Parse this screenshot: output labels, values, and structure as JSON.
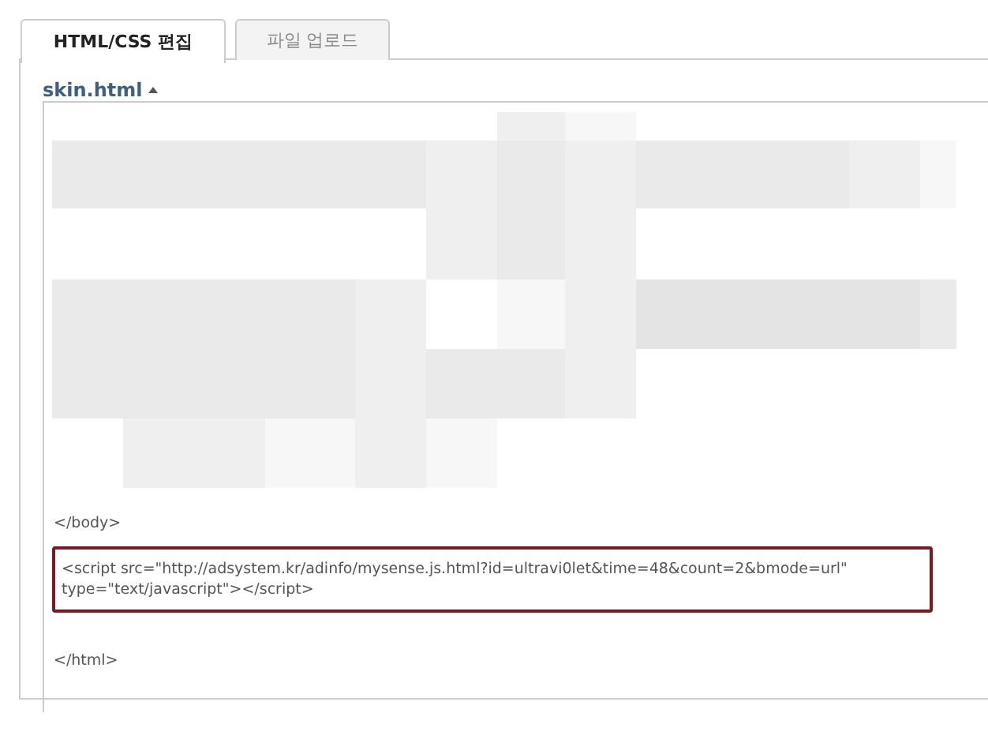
{
  "tabs": [
    {
      "label": "HTML/CSS 편집",
      "selected": true
    },
    {
      "label": "파일 업로드",
      "selected": false
    }
  ],
  "file": {
    "name": "skin.html"
  },
  "code_lines": [
    {
      "text": "</body>",
      "highlighted": false
    },
    {
      "text": "<script src=\"http://adsystem.kr/adinfo/mysense.js.html?id=ultravi0let&time=48&count=2&bmode=url\" type=\"text/javascript\"></script>",
      "highlighted": true
    },
    {
      "text": "</html>",
      "highlighted": false
    }
  ]
}
